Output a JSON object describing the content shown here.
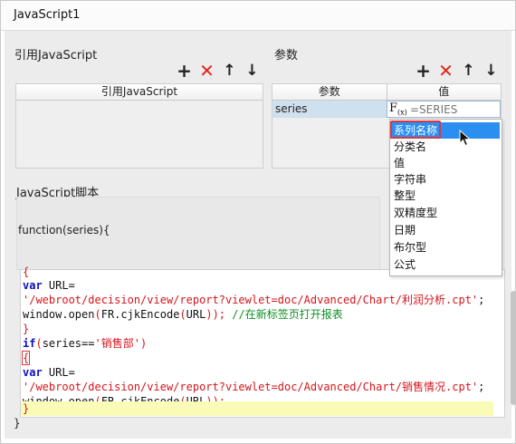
{
  "window": {
    "title": "JavaScript1"
  },
  "ref_js": {
    "label": "引用JavaScript",
    "column_header": "引用JavaScript"
  },
  "params": {
    "label": "参数",
    "headers": [
      "参数",
      "值"
    ],
    "row": {
      "name": "series",
      "value_placeholder": "=SERIES"
    },
    "fx_label": "F(x)"
  },
  "toolbar_icons": {
    "add": "plus-icon",
    "delete": "x-icon",
    "up": "arrow-up-icon",
    "down": "arrow-down-icon"
  },
  "dropdown": {
    "items": [
      "系列名称",
      "分类名",
      "值",
      "字符串",
      "整型",
      "双精度型",
      "日期",
      "布尔型",
      "公式"
    ],
    "selected_index": 0
  },
  "script": {
    "label": "JavaScript脚本",
    "signature": "function(series){",
    "closing": "}"
  },
  "code_text": {
    "l0": "{",
    "l1_kw": "var",
    "l1_rest": " URL=",
    "l2": "'/webroot/decision/view/report?viewlet=doc/Advanced/Chart/利润分析.cpt'",
    "l2_end": ";",
    "l3_a": "window.open",
    "l3_b": "(",
    "l3_c": "FR.cjkEncode",
    "l3_d": "(",
    "l3_e": "URL",
    "l3_f": "));",
    "l3_g": " //在新标签页打开报表",
    "l4": "}",
    "l5_kw": "if",
    "l5_a": "(",
    "l5_b": "series==",
    "l5_c": "'销售部'",
    "l5_d": ")",
    "l6": "{",
    "l7_kw": "var",
    "l7_rest": " URL=",
    "l8": "'/webroot/decision/view/report?viewlet=doc/Advanced/Chart/销售情况.cpt'",
    "l8_end": ";",
    "l9_a": "window.open",
    "l9_b": "(",
    "l9_c": "FR.cjkEncode",
    "l9_d": "(",
    "l9_e": "URL",
    "l9_f": "));",
    "l10": "}"
  },
  "colors": {
    "selection": "#2a8ff0",
    "delete_red": "#e2261d",
    "keyword_blue": "#1010c0",
    "string_red": "#d4161c",
    "comment_green": "#0f8f24",
    "line_highlight": "#fbfbb8"
  }
}
